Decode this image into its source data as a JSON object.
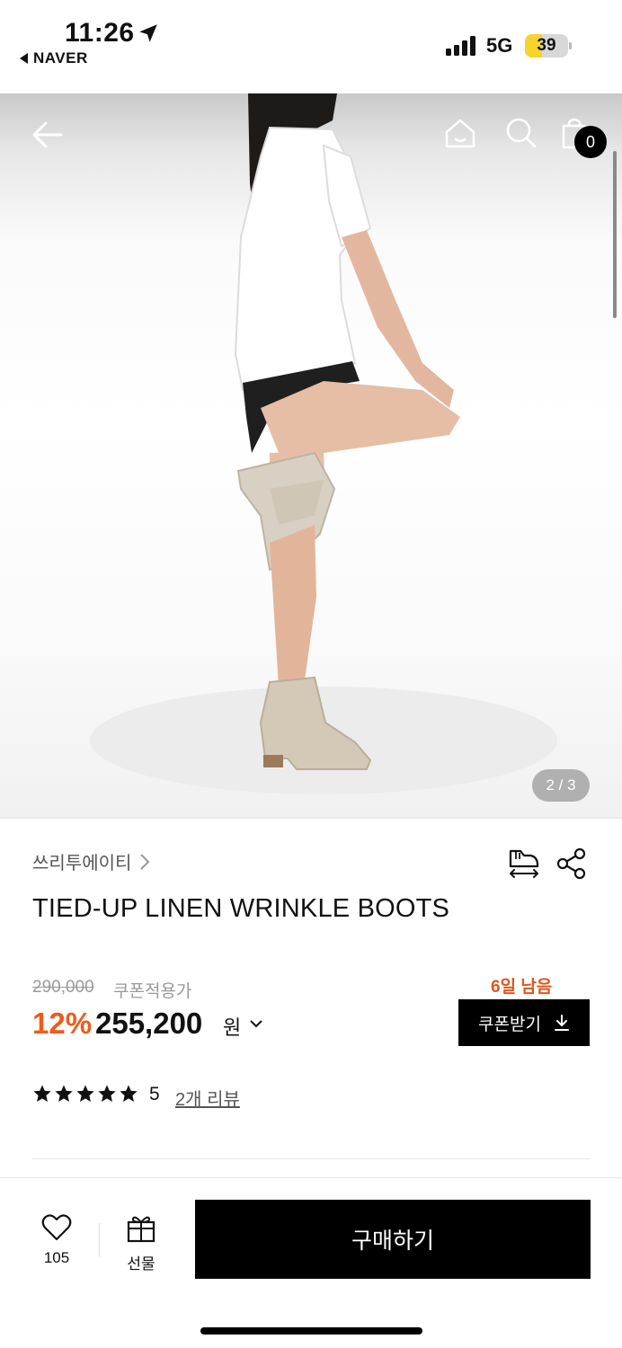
{
  "status_bar": {
    "time": "11:26",
    "back_app": "NAVER",
    "network": "5G",
    "battery": "39",
    "battery_level": 0.39,
    "icons": [
      "location-arrow-icon",
      "signal-icon",
      "battery-icon"
    ]
  },
  "hero": {
    "counter": "2 / 3",
    "cart_count": "0",
    "icons": [
      "back-arrow-icon",
      "home-icon",
      "search-icon",
      "cart-icon"
    ]
  },
  "product": {
    "brand": "쓰리투에이티",
    "title": "TIED-UP LINEN WRINKLE BOOTS",
    "original_price": "290,000",
    "coupon_note": "쿠폰적용가",
    "discount": "12%",
    "price": "255,200",
    "currency": "원",
    "days_left": "6일 남음",
    "coupon_button": "쿠폰받기",
    "rating": "5",
    "star_count": 5,
    "review_link": "2개 리뷰"
  },
  "bottom_bar": {
    "like_count": "105",
    "gift_label": "선물",
    "buy_label": "구매하기"
  },
  "colors": {
    "accent": "#f05a1a",
    "days_left": "#e0571e",
    "button_bg": "#000000",
    "battery": "#f7d42c"
  }
}
